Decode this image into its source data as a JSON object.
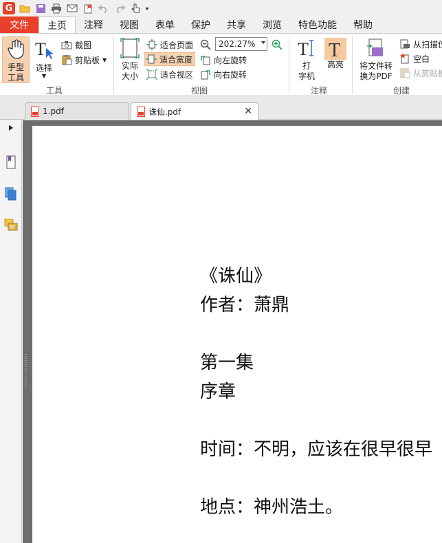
{
  "qat": {
    "icons": [
      "foxit-logo",
      "open-folder-icon",
      "save-icon",
      "print-icon",
      "email-icon",
      "new-blank-icon",
      "undo-icon",
      "redo-icon",
      "hand-cursor-icon",
      "customize-dropdown-icon"
    ]
  },
  "menu": {
    "file": "文件",
    "tabs": [
      "主页",
      "注释",
      "视图",
      "表单",
      "保护",
      "共享",
      "浏览",
      "特色功能",
      "帮助"
    ]
  },
  "ribbon": {
    "tools": {
      "hand": "手型\n工具",
      "select": "选择",
      "snapshot": "截图",
      "clipboard": "剪贴板",
      "label": "工具"
    },
    "view": {
      "actual_size": "实际\n大小",
      "fit_page": "适合页面",
      "fit_width": "适合宽度",
      "fit_visible": "适合视区",
      "zoom": "202.27%",
      "rotate_left": "向左旋转",
      "rotate_right": "向右旋转",
      "label": "视图"
    },
    "comment": {
      "typewriter": "打\n字机",
      "highlight": "高亮",
      "label": "注释"
    },
    "create": {
      "convert": "将文件转\n换为PDF",
      "from_scanner": "从扫描仪",
      "blank": "空白",
      "from_clipboard": "从剪贴板",
      "label": "创建"
    }
  },
  "doctabs": [
    {
      "label": "1.pdf",
      "active": false
    },
    {
      "label": "诛仙.pdf",
      "active": true
    }
  ],
  "document": {
    "lines": [
      "《诛仙》",
      "作者：萧鼎",
      "",
      "第一集",
      "序章",
      "",
      "时间：不明，应该在很早很早",
      "",
      "地点：神州浩土。"
    ]
  },
  "colors": {
    "accent": "#e8402a",
    "highlight": "#f6d2b4",
    "doc_bg": "#6e6e6e"
  }
}
